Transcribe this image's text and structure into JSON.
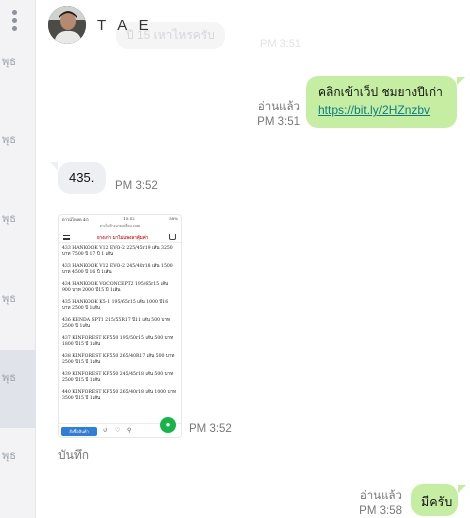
{
  "sidebar": {
    "items": [
      {
        "day": "พุธ",
        "active": false
      },
      {
        "day": "พุธ",
        "active": false
      },
      {
        "day": "พุธ",
        "active": false
      },
      {
        "day": "พุธ",
        "active": false
      },
      {
        "day": "พุธ",
        "active": true
      },
      {
        "day": "พุธ",
        "active": false
      }
    ]
  },
  "header": {
    "contact_name": "T A E",
    "ghost_message": "ปี 15 เหาไหรครับ",
    "ghost_time": "PM 3:51"
  },
  "messages": [
    {
      "direction": "out",
      "text": "คลิกเข้าเว็ป ชมยางปีเก่า",
      "link": "https://bit.ly/2HZnzbv",
      "status": "อ่านแล้ว",
      "time": "PM 3:51"
    },
    {
      "direction": "in",
      "text": "435.",
      "time": "PM 3:52"
    },
    {
      "direction": "in",
      "type": "image",
      "time": "PM 3:52",
      "save_label": "บันทึก",
      "image": {
        "status_left": "ดาวน์โหลด 4G",
        "status_center": "15:52",
        "status_right": "58%",
        "url": "ยางไม่ล้างนายเปลี่ยน.com",
        "brand": "ยางเก่า มาไม่แพงลาคุ้มค่า",
        "lines": [
          "433 HANKOOK V12 EVO-2 225/45r19 เส้น 3250 บาท 7500 ปี 17 ปี 1 เส้น",
          "433 HANKOOK V12 EVO-2 245/40r18 เส้น 1500 บาท 4500 ปี 16 ปี 1เส้น",
          "434 HANKOOK VOCONCEPT2 195/65r15 เส้น 900 บาท 2000 ปี15 ปี 1เส้น",
          "435 HANKOOK K5-1 195/65r15 เส้น 1000 ปี16 บาท 2500 ปี 1เส้น",
          "436 KENDA SPT1 215/55R17 ปี11 เส้น 500 บาท 2500 ปี 1เส้น",
          "437 KINFOREST KF550 195/50r15 เส้น 500 บาท 1800 ปี15 ปี 1เส้น",
          "438 KINFOREST KF550 265/40R17 เส้น 500 บาท 2500 ปี15 ปี 1เส้น",
          "439 KINFOREST KF550 245/45r18 เส้น 500 บาท 2500 ปี15 ปี 1เส้น",
          "440 KINFOREST KF550 265/40r18 เส้น 1000 บาท 3500 ปี15 ปี 1เส้น"
        ],
        "cta": "สั่งซื้อสินค้า"
      }
    },
    {
      "direction": "out",
      "text": "มีครับ",
      "status": "อ่านแล้ว",
      "time": "PM 3:58"
    }
  ],
  "colors": {
    "outgoing_bubble": "#c6eea3",
    "incoming_bubble": "#eeeff3",
    "link": "#0d7c86",
    "meta_text": "#777777"
  }
}
